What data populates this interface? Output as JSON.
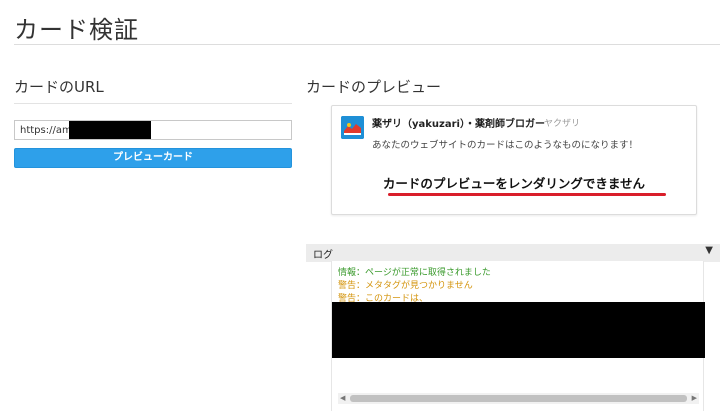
{
  "page": {
    "title": "カード検証"
  },
  "url_section": {
    "heading": "カードのURL",
    "input_value": "https://amz",
    "button_label": "プレビューカード"
  },
  "preview_section": {
    "heading": "カードのプレビュー",
    "card": {
      "site_title": "薬ザリ（yakuzari）・薬剤師ブロガー",
      "author": "ヤクザリ",
      "description": "あなたのウェブサイトのカードはこのようなものになります！",
      "error_message": "カードのプレビューをレンダリングできません",
      "icon": "site-logo-icon"
    }
  },
  "log": {
    "label": "ログ",
    "toggle_icon": "triangle-down-icon",
    "lines": {
      "info": "情報：ページが正常に取得されました",
      "warn_meta": "警告：メタタグが見つかりません",
      "warn_card": "警告：このカードは、"
    }
  },
  "colors": {
    "button": "#2ea0ea",
    "underline": "#d91e2a",
    "info": "#3a9a2c",
    "warning": "#d4950e"
  }
}
